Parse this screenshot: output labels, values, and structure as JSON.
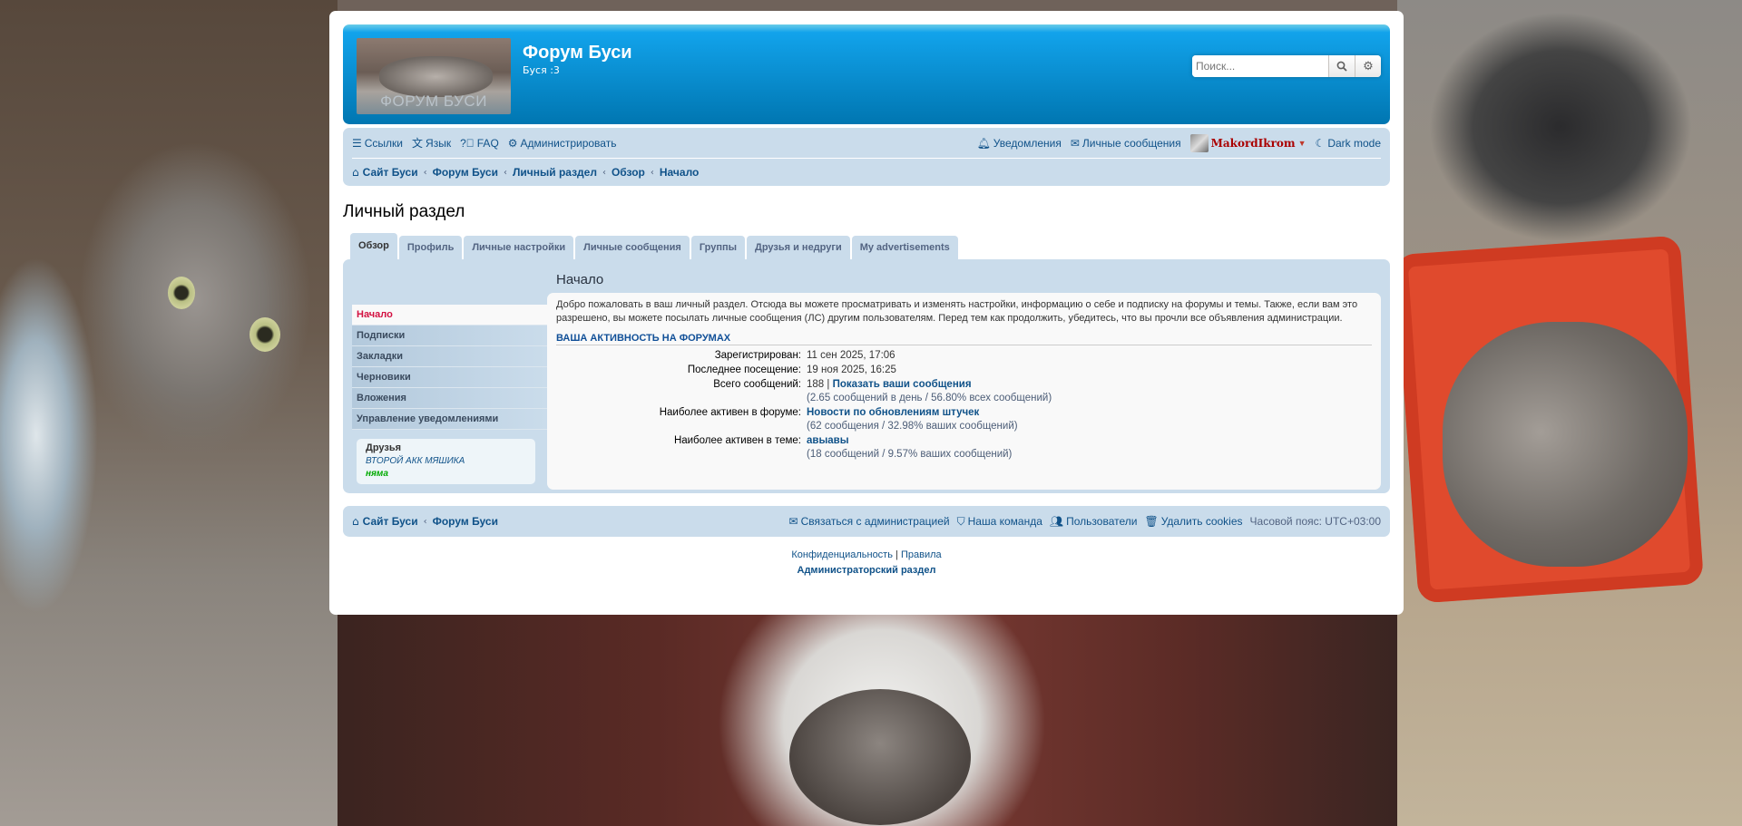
{
  "header": {
    "site_title": "Форум Буси",
    "site_description": "Буся :3",
    "logo_text": "ФОРУМ БУСИ",
    "search_placeholder": "Поиск..."
  },
  "navbar": {
    "left": [
      {
        "label": "Ссылки",
        "icon": "bars-icon"
      },
      {
        "label": "Язык",
        "icon": "language-icon"
      },
      {
        "label": "FAQ",
        "icon": "question-circle-icon"
      },
      {
        "label": "Администрировать",
        "icon": "cogs-icon"
      }
    ],
    "right": {
      "notifications": "Уведомления",
      "messages": "Личные сообщения",
      "username": "MakordIkrom",
      "dark_mode": "Dark mode"
    }
  },
  "breadcrumbs": [
    "Сайт Буси",
    "Форум Буси",
    "Личный раздел",
    "Обзор",
    "Начало"
  ],
  "page_title": "Личный раздел",
  "tabs": [
    "Обзор",
    "Профиль",
    "Личные настройки",
    "Личные сообщения",
    "Группы",
    "Друзья и недруги",
    "My advertisements"
  ],
  "sidebar": {
    "items": [
      "Начало",
      "Подписки",
      "Закладки",
      "Черновики",
      "Вложения",
      "Управление уведомлениями"
    ],
    "friends_title": "Друзья",
    "friends": [
      "ВТОРОЙ АКК МЯШИКА",
      "няма"
    ]
  },
  "content": {
    "heading": "Начало",
    "intro": "Добро пожаловать в ваш личный раздел. Отсюда вы можете просматривать и изменять настройки, информацию о себе и подписку на форумы и темы. Также, если вам это разрешено, вы можете посылать личные сообщения (ЛС) другим пользователям. Перед тем как продолжить, убедитесь, что вы прочли все объявления администрации.",
    "activity_title": "Ваша активность на форумах",
    "stats": {
      "registered_label": "Зарегистрирован:",
      "registered_value": "11 сен 2025, 17:06",
      "last_visit_label": "Последнее посещение:",
      "last_visit_value": "19 ноя 2025, 16:25",
      "posts_label": "Всего сообщений:",
      "posts_value": "188 |",
      "posts_link": "Показать ваши сообщения",
      "posts_sub": "(2.65 сообщений в день / 56.80% всех сообщений)",
      "active_forum_label": "Наиболее активен в форуме:",
      "active_forum_link": "Новости по обновлениям штучек",
      "active_forum_sub": "(62 сообщения / 32.98% ваших сообщений)",
      "active_topic_label": "Наиболее активен в теме:",
      "active_topic_link": "авыавы",
      "active_topic_sub": "(18 сообщений / 9.57% ваших сообщений)"
    }
  },
  "footer": {
    "crumbs": [
      "Сайт Буси",
      "Форум Буси"
    ],
    "contact": "Связаться с администрацией",
    "team": "Наша команда",
    "members": "Пользователи",
    "delete_cookies": "Удалить cookies",
    "timezone": "Часовой пояс: UTC+03:00",
    "privacy": "Конфиденциальность",
    "rules": "Правила",
    "admin_panel": "Администраторский раздел"
  },
  "colors": {
    "header_gradient_top": "#12a3eb",
    "header_gradient_bottom": "#0076b1",
    "navbar_bg": "#cadceb",
    "link": "#105289",
    "active_menu": "#d31141",
    "username": "#aa0000"
  }
}
